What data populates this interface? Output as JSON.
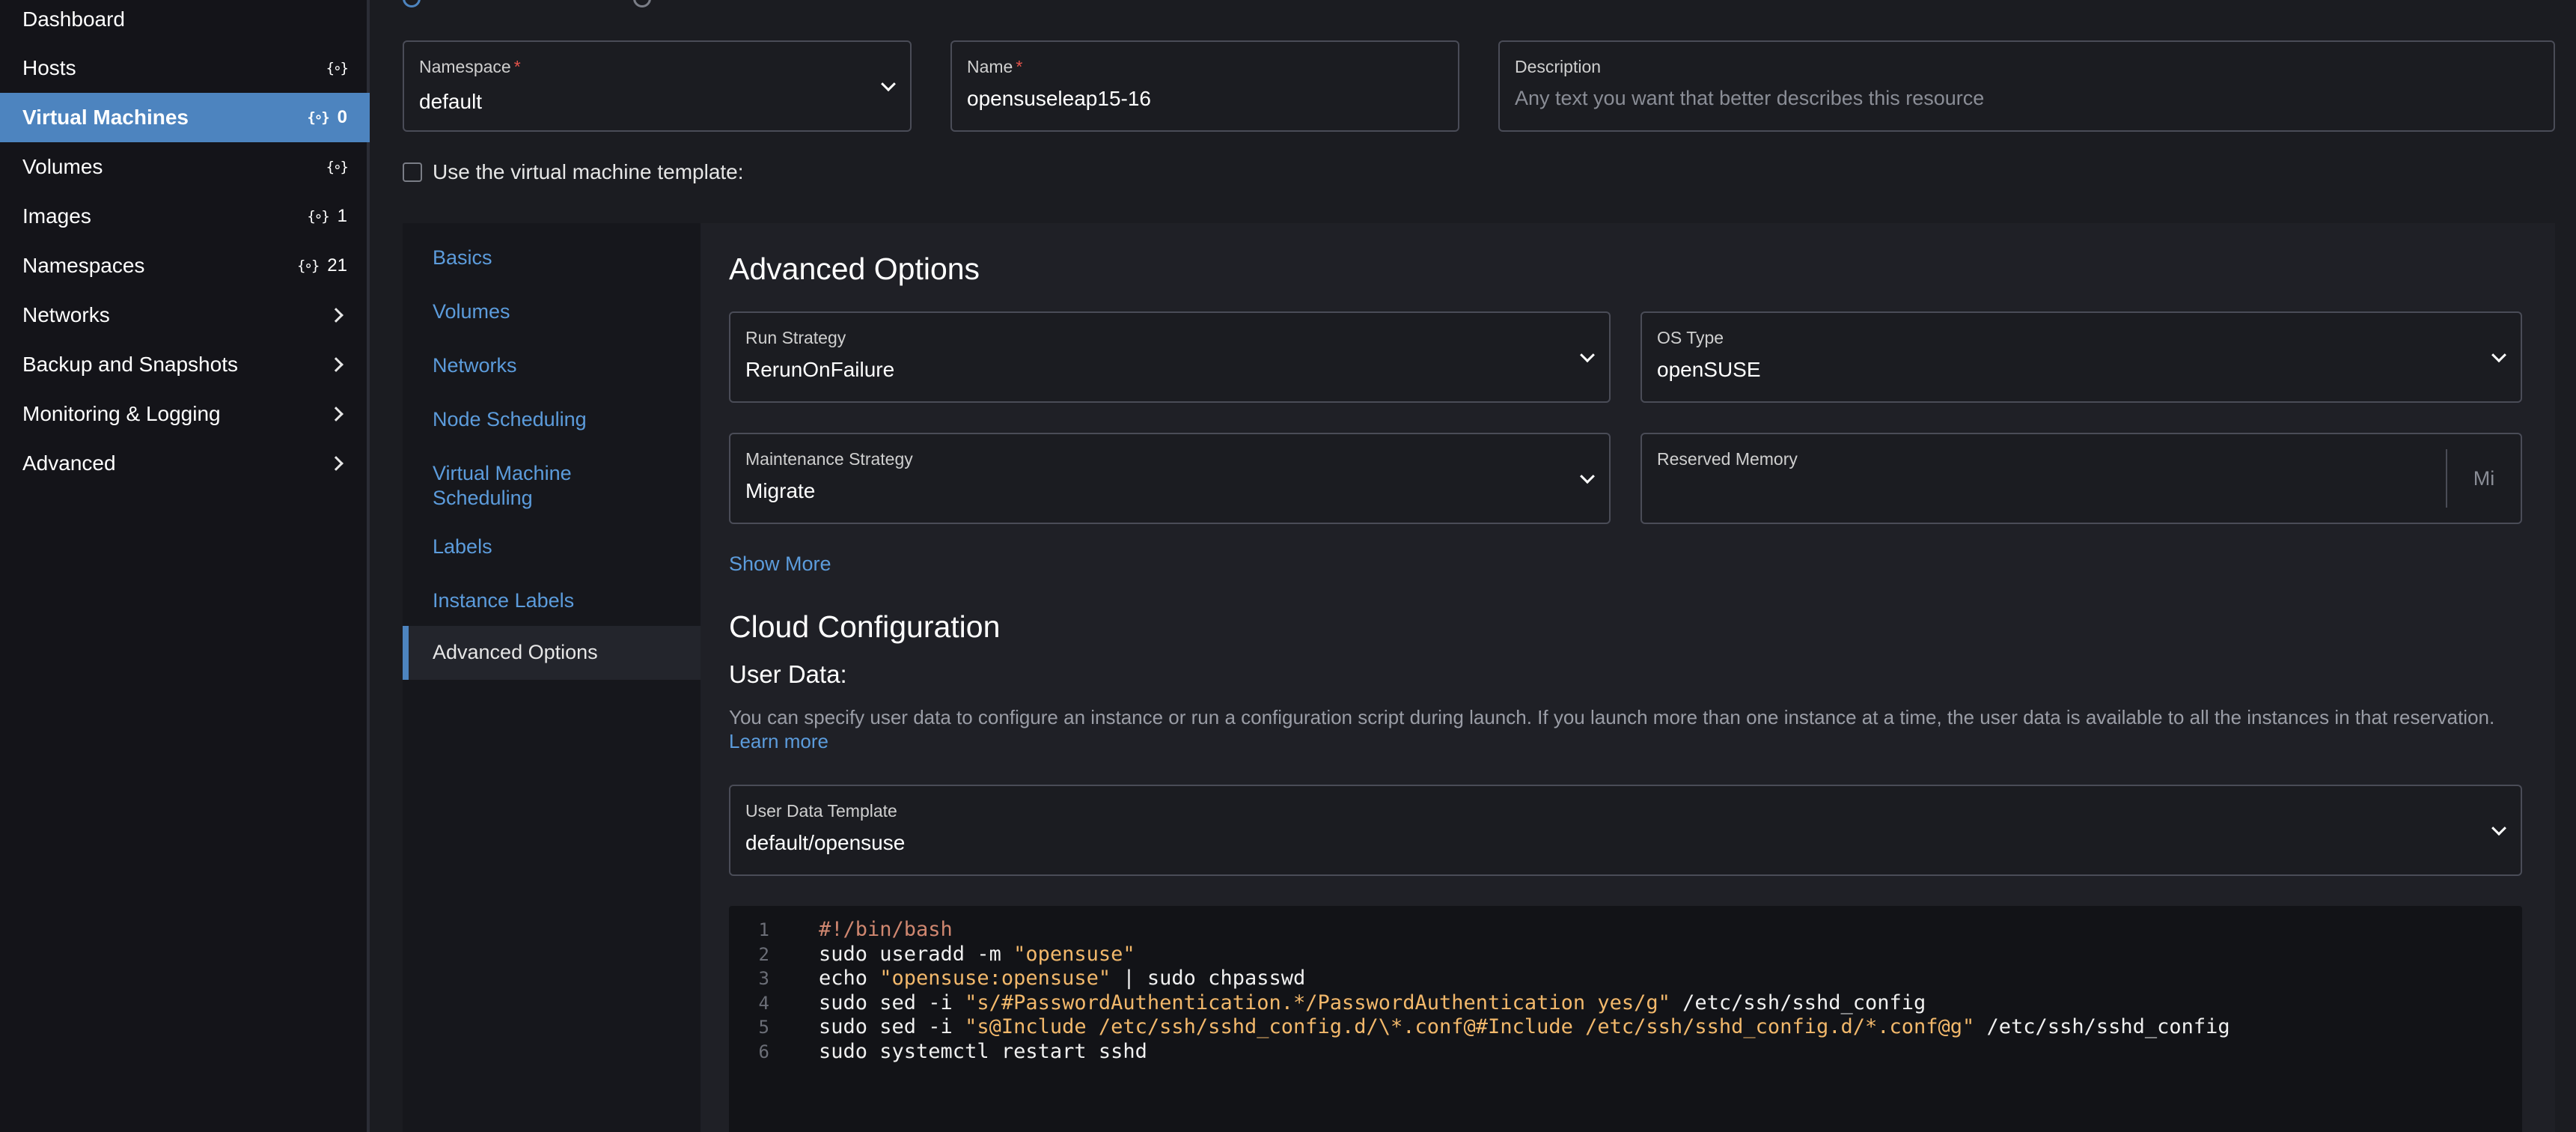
{
  "sidebar": {
    "items": [
      {
        "label": "Dashboard",
        "badge_icon": "",
        "count": "",
        "chevron": false,
        "active": false
      },
      {
        "label": "Hosts",
        "badge_icon": "resource-icon",
        "count": "",
        "chevron": false,
        "active": false
      },
      {
        "label": "Virtual Machines",
        "badge_icon": "resource-icon",
        "count": "0",
        "chevron": false,
        "active": true
      },
      {
        "label": "Volumes",
        "badge_icon": "resource-icon",
        "count": "",
        "chevron": false,
        "active": false
      },
      {
        "label": "Images",
        "badge_icon": "resource-icon",
        "count": "1",
        "chevron": false,
        "active": false
      },
      {
        "label": "Namespaces",
        "badge_icon": "resource-icon",
        "count": "21",
        "chevron": false,
        "active": false
      },
      {
        "label": "Networks",
        "badge_icon": "",
        "count": "",
        "chevron": true,
        "active": false
      },
      {
        "label": "Backup and Snapshots",
        "badge_icon": "",
        "count": "",
        "chevron": true,
        "active": false
      },
      {
        "label": "Monitoring & Logging",
        "badge_icon": "",
        "count": "",
        "chevron": true,
        "active": false
      },
      {
        "label": "Advanced",
        "badge_icon": "",
        "count": "",
        "chevron": true,
        "active": false
      }
    ],
    "resource_glyph": "{∘}"
  },
  "form": {
    "namespace": {
      "label": "Namespace",
      "required_mark": "*",
      "value": "default"
    },
    "name": {
      "label": "Name",
      "required_mark": "*",
      "value": "opensuseleap15-16"
    },
    "description": {
      "label": "Description",
      "placeholder": "Any text you want that better describes this resource",
      "value": ""
    },
    "use_template_label": "Use the virtual machine template:",
    "use_template_checked": false
  },
  "tabs": [
    {
      "label": "Basics",
      "active": false
    },
    {
      "label": "Volumes",
      "active": false
    },
    {
      "label": "Networks",
      "active": false
    },
    {
      "label": "Node Scheduling",
      "active": false
    },
    {
      "label": "Virtual Machine Scheduling",
      "active": false
    },
    {
      "label": "Labels",
      "active": false
    },
    {
      "label": "Instance Labels",
      "active": false
    },
    {
      "label": "Advanced Options",
      "active": true
    }
  ],
  "advanced": {
    "title": "Advanced Options",
    "run_strategy": {
      "label": "Run Strategy",
      "value": "RerunOnFailure"
    },
    "os_type": {
      "label": "OS Type",
      "value": "openSUSE"
    },
    "maintenance_strategy": {
      "label": "Maintenance Strategy",
      "value": "Migrate"
    },
    "reserved_memory": {
      "label": "Reserved Memory",
      "value": "",
      "unit": "Mi"
    },
    "show_more": "Show More"
  },
  "cloud_config": {
    "title": "Cloud Configuration",
    "user_data_title": "User Data:",
    "help_text": "You can specify user data to configure an instance or run a configuration script during launch. If you launch more than one instance at a time, the user data is available to all the instances in that reservation.",
    "learn_more": "Learn more",
    "template": {
      "label": "User Data Template",
      "value": "default/opensuse"
    },
    "code_lines": [
      "#!/bin/bash",
      "sudo useradd -m \"opensuse\"",
      "echo \"opensuse:opensuse\" | sudo chpasswd",
      "sudo sed -i \"s/#PasswordAuthentication.*/PasswordAuthentication yes/g\" /etc/ssh/sshd_config",
      "sudo sed -i \"s@Include /etc/ssh/sshd_config.d/\\*.conf@#Include /etc/ssh/sshd_config.d/*.conf@g\" /etc/ssh/sshd_config",
      "sudo systemctl restart sshd"
    ]
  },
  "colors": {
    "accent": "#4d84bf",
    "link": "#5c9cdc",
    "required": "#e5534b",
    "string": "#f2b86b",
    "comment": "#d08770"
  }
}
